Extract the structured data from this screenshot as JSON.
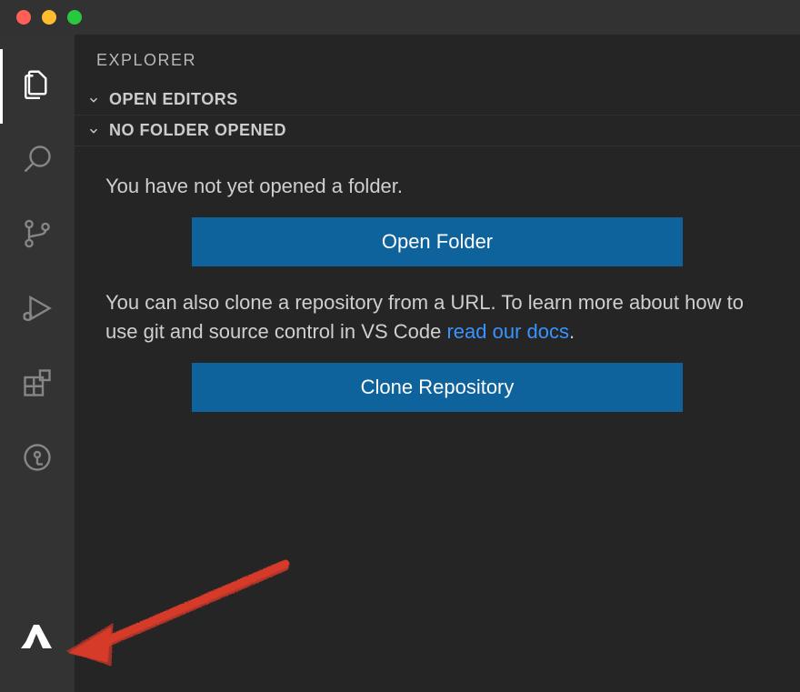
{
  "sidebar": {
    "title": "EXPLORER",
    "sections": {
      "openEditors": "OPEN EDITORS",
      "noFolder": "NO FOLDER OPENED"
    },
    "noFolderPanel": {
      "intro": "You have not yet opened a folder.",
      "openFolderBtn": "Open Folder",
      "cloneText1": "You can also clone a repository from a URL. To learn more about how to use git and source control in VS Code ",
      "readDocsLink": "read our docs",
      "cloneText2": ".",
      "cloneRepoBtn": "Clone Repository"
    }
  },
  "activityBar": {
    "explorer": "explorer",
    "search": "search",
    "scm": "source-control",
    "debug": "run-and-debug",
    "extensions": "extensions",
    "gitlens": "git-lens",
    "azure": "azure"
  }
}
